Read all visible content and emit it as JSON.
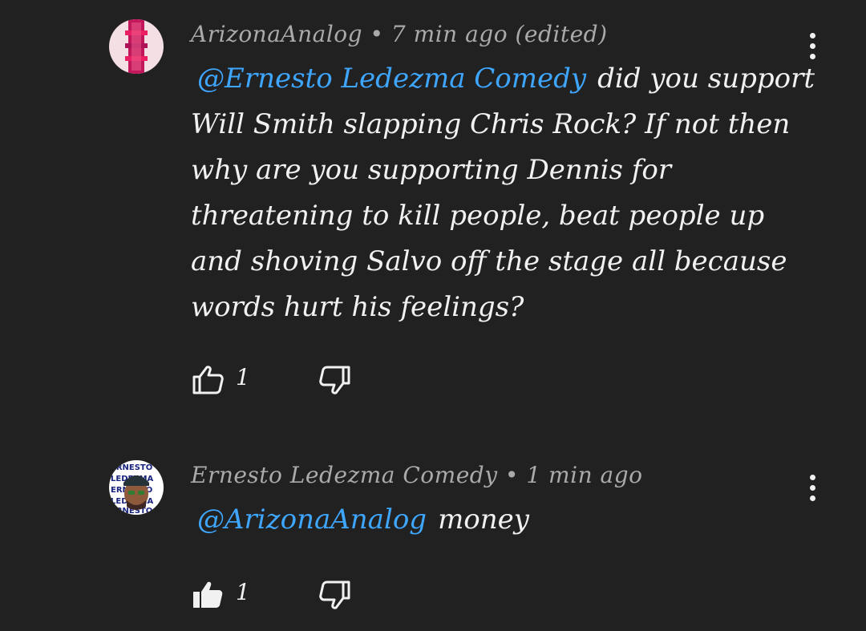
{
  "comments": [
    {
      "author": "ArizonaAnalog",
      "separator": "•",
      "time": "7 min ago (edited)",
      "mention": "@Ernesto Ledezma Comedy",
      "text": "did you support Will Smith slapping Chris Rock? If not then why are you supporting Dennis for threatening to kill people, beat people up and shoving Salvo off the stage all because words hurt his feelings?",
      "like_count": "1",
      "liked": false,
      "avatar_icon": "pink-pillar-avatar"
    },
    {
      "author": "Ernesto Ledezma Comedy",
      "separator": "•",
      "time": "1 min ago",
      "mention": "@ArizonaAnalog",
      "text": "money",
      "like_count": "1",
      "liked": true,
      "avatar_icon": "ernesto-ledezma-avatar",
      "avatar_lettering": "ERNESTO LEDEZMA"
    }
  ],
  "icons": {
    "like": "thumbs-up-icon",
    "dislike": "thumbs-down-icon",
    "menu": "more-vert-icon"
  },
  "colors": {
    "background": "#212121",
    "mention": "#3ea6ff",
    "meta": "#aaaaaa",
    "text": "#f1f1f1"
  }
}
